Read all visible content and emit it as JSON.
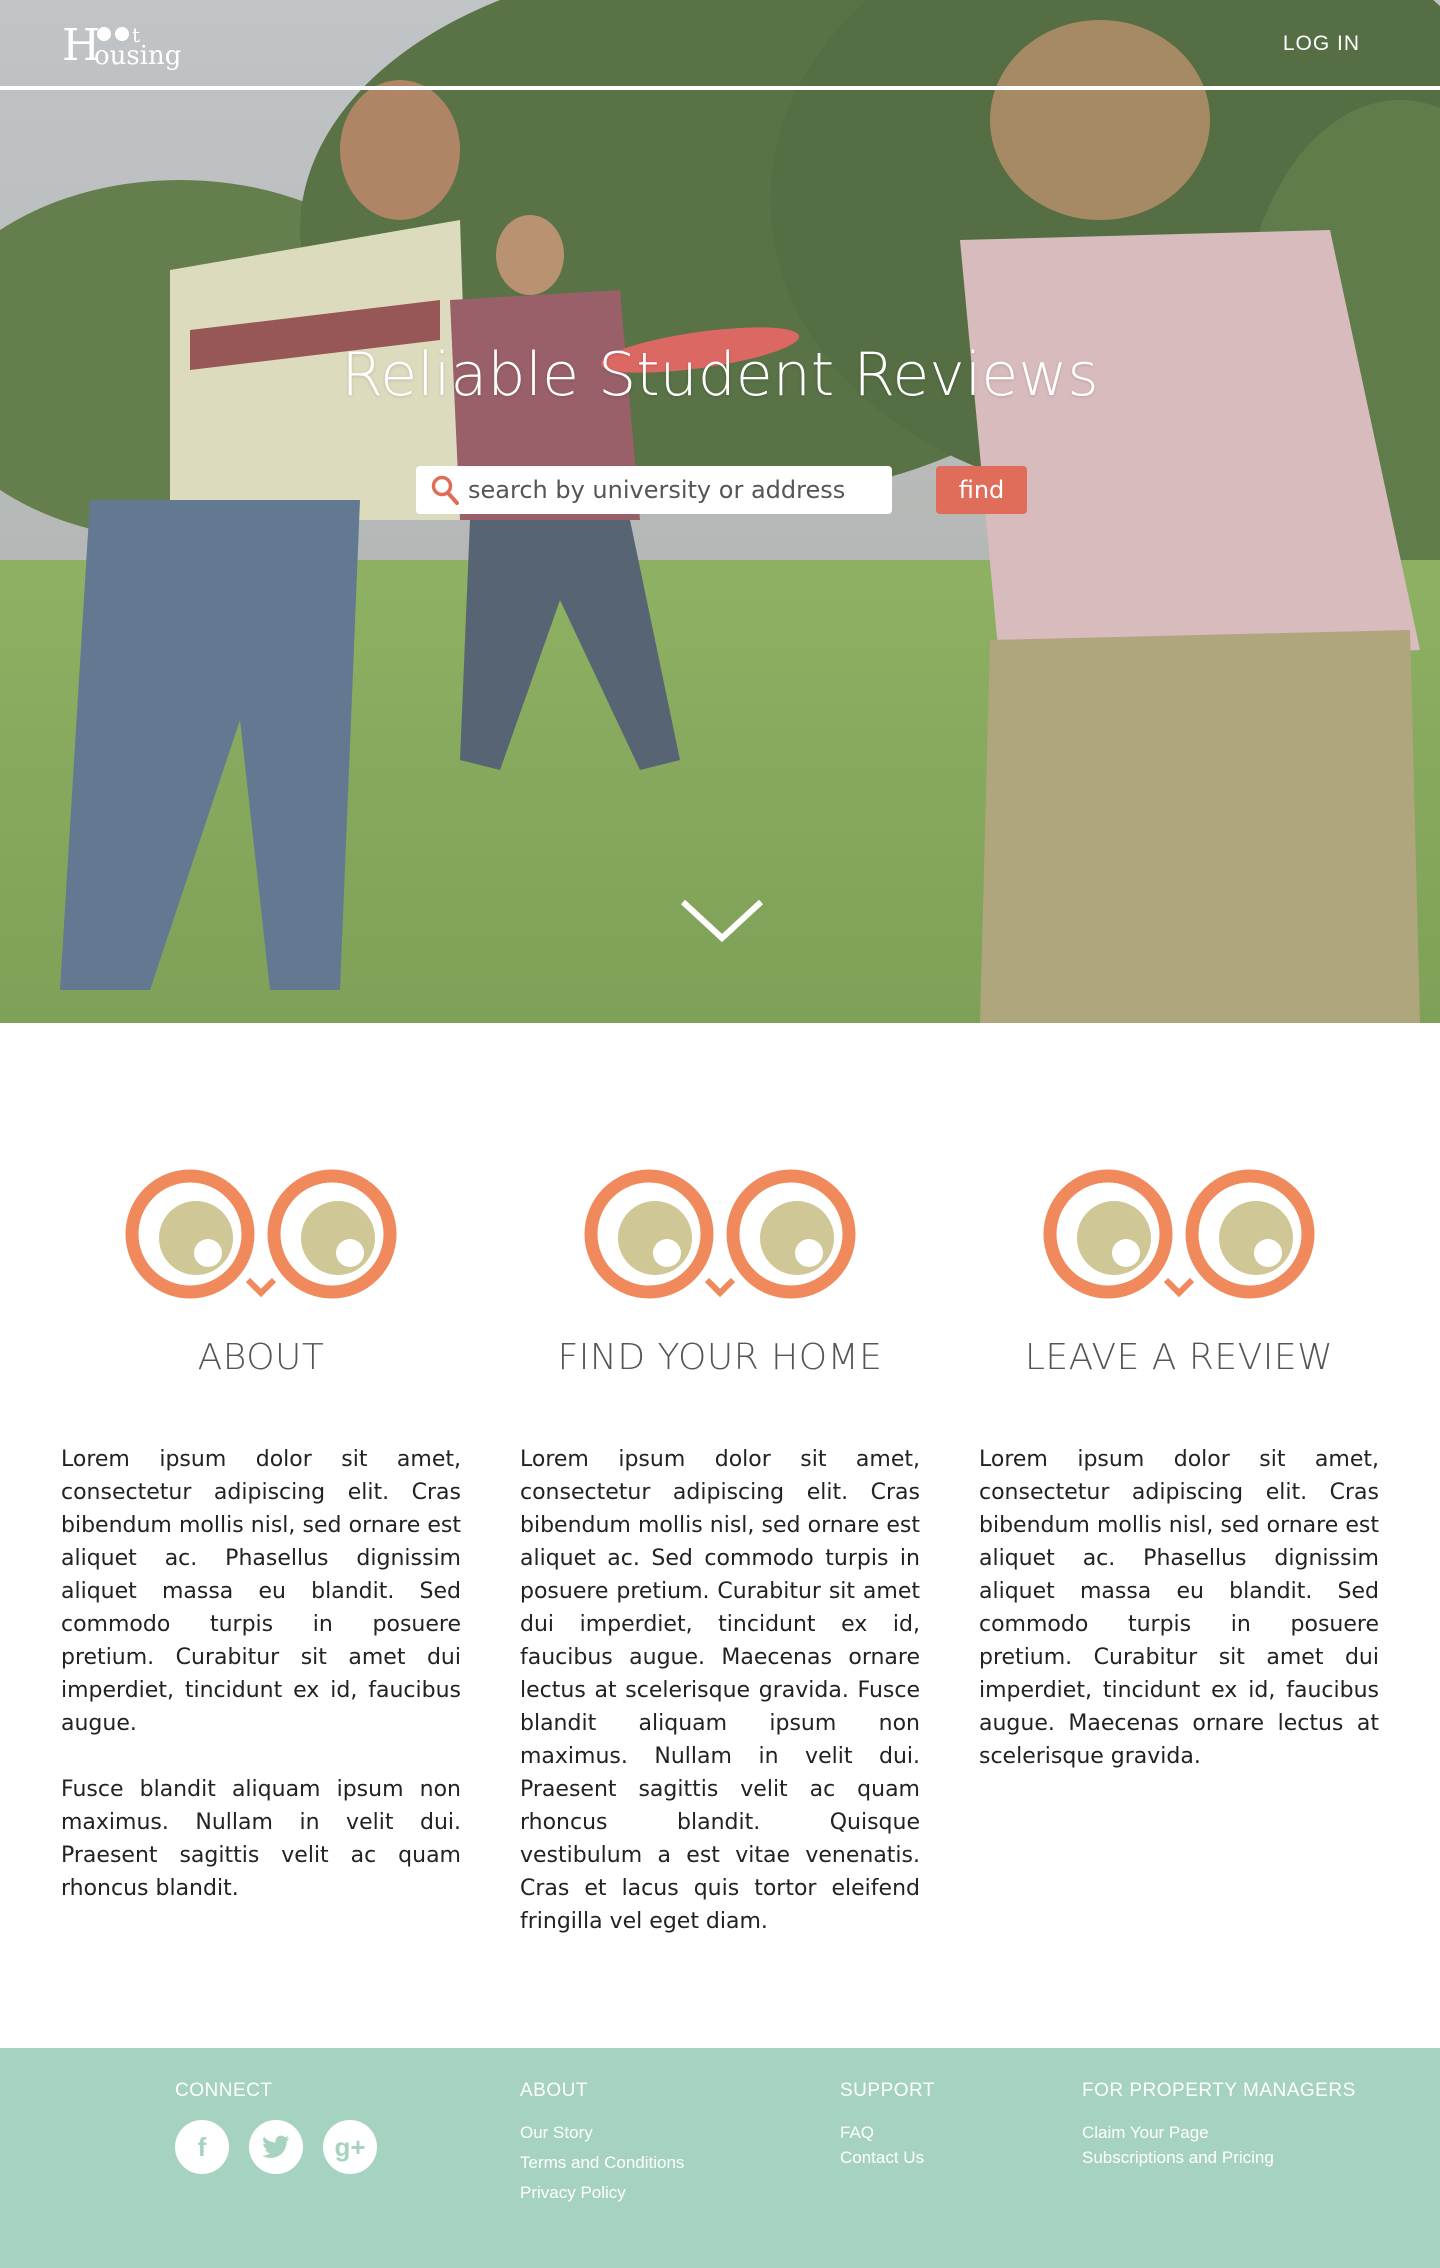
{
  "header": {
    "logo_text": "Hoot Housing",
    "login_label": "LOG IN"
  },
  "hero": {
    "headline": "Reliable Student Reviews",
    "search_placeholder": "search by university or address",
    "find_label": "find",
    "icons": [
      "search-icon",
      "chevron-down-icon"
    ]
  },
  "features": [
    {
      "title": "ABOUT",
      "icon": "owl-eyes-icon",
      "paragraphs": [
        "Lorem ipsum dolor sit amet, consectetur adipiscing elit. Cras bibendum mollis nisl, sed ornare est aliquet ac. Phasellus dignissim aliquet massa eu blandit. Sed commodo turpis in posuere pretium. Curabitur sit amet dui imperdiet, tincidunt ex id, faucibus augue.",
        "Fusce blandit aliquam ipsum non maximus. Nullam in velit dui. Praesent sagittis velit ac quam rhoncus blandit."
      ]
    },
    {
      "title": "FIND YOUR HOME",
      "icon": "owl-eyes-icon",
      "paragraphs": [
        "Lorem ipsum dolor sit amet, consectetur adipiscing elit. Cras bibendum mollis nisl, sed ornare est aliquet ac. Sed commodo turpis in posuere pretium. Curabitur sit amet dui imperdiet, tincidunt ex id, faucibus augue. Maecenas ornare lectus at scelerisque gravida. Fusce blandit aliquam ipsum non maximus. Nullam in velit dui. Praesent sagittis velit ac quam rhoncus blandit. Quisque vestibulum a est vitae venenatis. Cras et lacus quis tortor eleifend fringilla vel eget diam."
      ]
    },
    {
      "title": "LEAVE A REVIEW",
      "icon": "owl-eyes-icon",
      "paragraphs": [
        "Lorem ipsum dolor sit amet, consectetur adipiscing elit. Cras bibendum mollis nisl, sed ornare est aliquet ac. Phasellus dignissim aliquet massa eu blandit. Sed commodo turpis in posuere pretium. Curabitur sit amet dui imperdiet, tincidunt ex id, faucibus augue. Maecenas ornare lectus at scelerisque gravida."
      ]
    }
  ],
  "footer": {
    "connect": {
      "heading": "CONNECT",
      "icons": [
        "facebook-icon",
        "twitter-icon",
        "google-plus-icon"
      ],
      "facebook_glyph": "f",
      "google_glyph": "g+"
    },
    "about": {
      "heading": "ABOUT",
      "links": [
        "Our Story",
        "Terms and Conditions",
        "Privacy Policy"
      ]
    },
    "support": {
      "heading": "SUPPORT",
      "links": [
        "FAQ",
        "Contact Us"
      ]
    },
    "property": {
      "heading": "FOR PROPERTY MANAGERS",
      "links": [
        "Claim Your Page",
        "Subscriptions and Pricing"
      ]
    }
  },
  "colors": {
    "accent": "#e06c5a",
    "owl_ring": "#f08a5d",
    "owl_pupil": "#cfc795",
    "footer_bg": "#a5d3bf"
  }
}
